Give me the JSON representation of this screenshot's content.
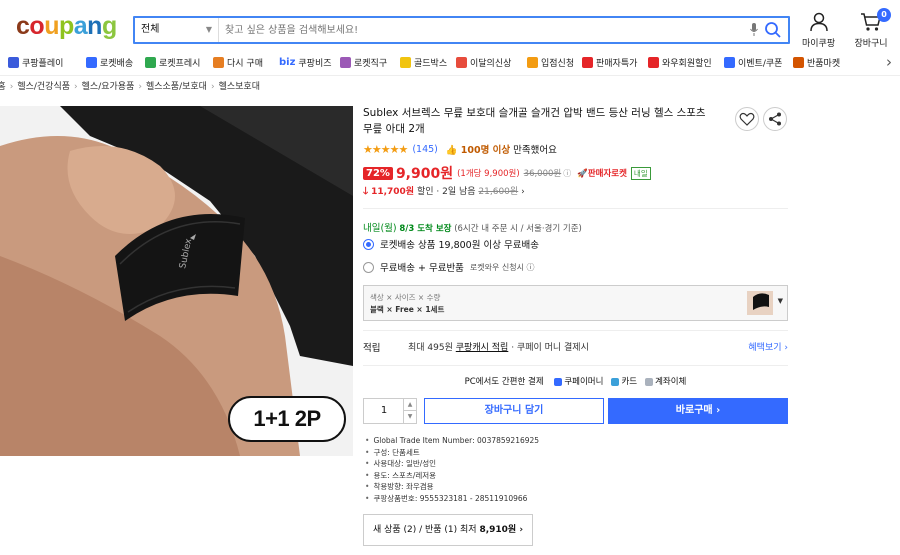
{
  "header": {
    "logo": {
      "letters": [
        "c",
        "o",
        "u",
        "p",
        "a",
        "n",
        "g"
      ],
      "colors": [
        "#8b3a1a",
        "#d7262c",
        "#f0a020",
        "#8fc31f",
        "#3ba0d9",
        "#1d70b7",
        "#8cc63f"
      ]
    },
    "search": {
      "category": "전체",
      "placeholder": "찾고 싶은 상품을 검색해보세요!"
    },
    "mypage_label": "마이쿠팡",
    "cart_label": "장바구니",
    "cart_count": "0"
  },
  "menu": [
    {
      "label": "쿠팡플레이",
      "color": "#3b5bdb"
    },
    {
      "label": "로켓배송",
      "color": "#346aff"
    },
    {
      "label": "로켓프레시",
      "color": "#2fa84f"
    },
    {
      "label": "다시 구매",
      "color": "#e67e22"
    },
    {
      "label": "쿠팡비즈",
      "prefix": "biz",
      "color": "#346aff"
    },
    {
      "label": "로켓직구",
      "color": "#9b59b6"
    },
    {
      "label": "골드박스",
      "color": "#f1c40f"
    },
    {
      "label": "이달의신상",
      "color": "#e74c3c"
    },
    {
      "label": "입점신청",
      "color": "#f39c12"
    },
    {
      "label": "판매자특가",
      "color": "#e52528"
    },
    {
      "label": "와우회원할인",
      "color": "#e52528"
    },
    {
      "label": "이벤트/쿠폰",
      "color": "#346aff"
    },
    {
      "label": "반품마켓",
      "color": "#d35400"
    }
  ],
  "breadcrumb": [
    "쿠팡 홈",
    "헬스/건강식품",
    "헬스/요가용품",
    "헬스소품/보호대",
    "헬스보호대"
  ],
  "product": {
    "image_badge": "1+1 2P",
    "title": "Sublex 서브렉스 무릎 보호대 슬개골 슬개건 압박 밴드 등산 러닝 헬스 스포츠 무릎 아대 2개",
    "rating_count": "(145)",
    "satisfied_bold": "100명 이상",
    "satisfied_rest": "만족했어요",
    "discount": "72%",
    "sale_price": "9,900원",
    "unit_price": "(1개당 9,900원)",
    "original_price": "36,000원",
    "rocket_seller": "판매자로켓",
    "rocket_tag": "내일",
    "coupon_price": "11,700원",
    "coupon_text": "할인 · 2일 남음",
    "coupon_strike": "21,600원"
  },
  "delivery": {
    "date": "내일(월)",
    "date_detail": "8/3 도착 보장",
    "note": "(6시간 내 주문 시 / 서울·경기 기준)",
    "option1": "로켓배송 상품 19,800원 이상 무료배송",
    "option2": "무료배송 + 무료반품",
    "option2_sub": "로켓와우 신청시 ⓘ"
  },
  "options": {
    "labels": "색상 × 사이즈 × 수량",
    "values": "블랙 × Free × 1세트"
  },
  "reward": {
    "label": "적립",
    "text_pre": "최대 495원",
    "text_link": "쿠팡캐시 적립",
    "text_post": "· 쿠페이 머니 결제시",
    "benefit": "혜택보기 ›"
  },
  "pay": {
    "title": "PC에서도 간편한 결제",
    "methods": [
      {
        "label": "쿠페이머니",
        "color": "#346aff"
      },
      {
        "label": "카드",
        "color": "#3ba0d9"
      },
      {
        "label": "계좌이체",
        "color": "#aab2bd"
      }
    ]
  },
  "purchase": {
    "quantity": "1",
    "cart_button": "장바구니 담기",
    "buy_button": "바로구매 ›"
  },
  "attributes": [
    "Global Trade Item Number: 0037859216925",
    "구성: 단품세트",
    "사용대상: 일반/성인",
    "용도: 스포츠/레저용",
    "착용방향: 좌우겸용",
    "쿠팡상품번호: 9555323181 - 28511910966"
  ],
  "other_sellers": {
    "text": "새 상품 (2) / 반품 (1) 최저",
    "price": "8,910원 ›"
  }
}
